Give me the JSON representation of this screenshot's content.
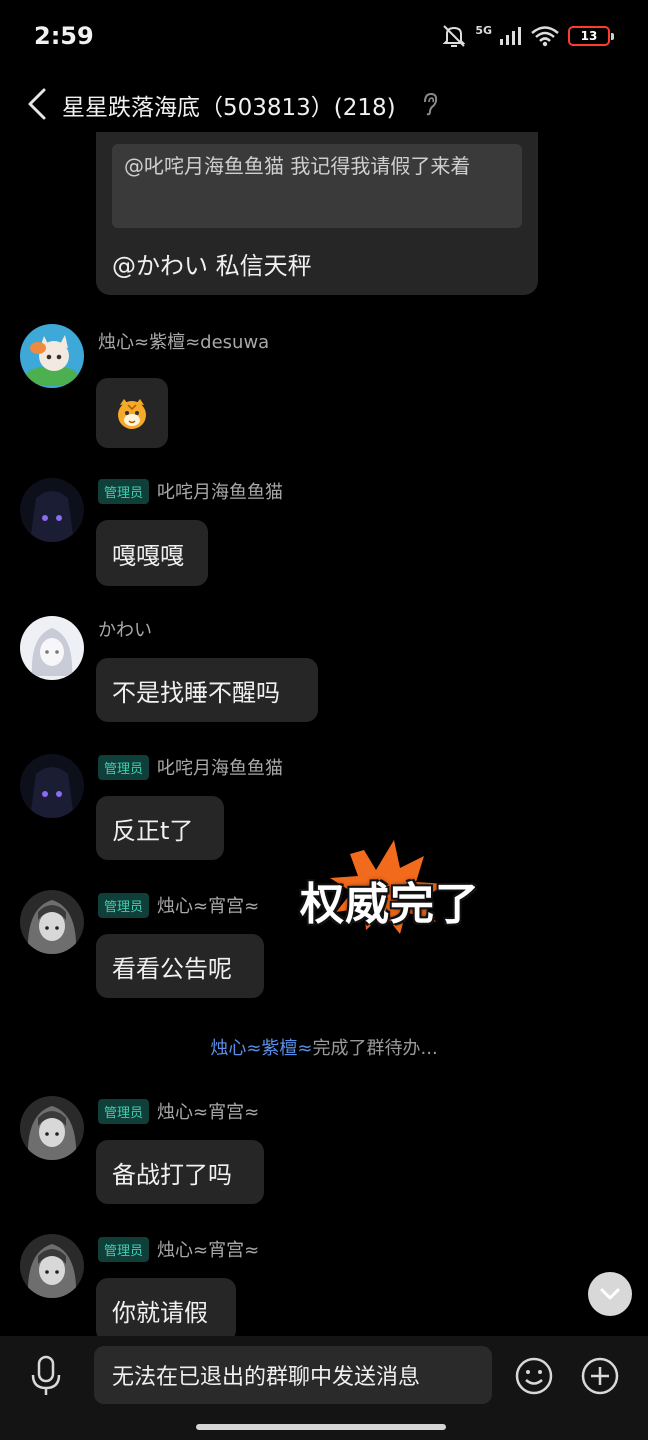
{
  "status": {
    "time": "2:59",
    "network": "5G",
    "battery": "13"
  },
  "header": {
    "title": "星星跌落海底（503813）(218)",
    "ear_icon": "hearing-icon"
  },
  "quote_message": {
    "quoted_text": "@叱咤月海鱼鱼猫 我记得我请假了来着",
    "reply_text": "@かわい 私信天秤"
  },
  "messages": [
    {
      "sender": "烛心≈紫檀≈desuwa",
      "admin": false,
      "text": "",
      "sticker": "tiger-emoji"
    },
    {
      "sender": "叱咤月海鱼鱼猫",
      "admin": true,
      "badge": "管理员",
      "text": "嘎嘎嘎"
    },
    {
      "sender": "かわい",
      "admin": false,
      "text": "不是找睡不醒吗"
    },
    {
      "sender": "叱咤月海鱼鱼猫",
      "admin": true,
      "badge": "管理员",
      "text": "反正t了"
    },
    {
      "sender": "烛心≈宵宫≈",
      "admin": true,
      "badge": "管理员",
      "text": "看看公告呢"
    },
    {
      "sender": "烛心≈宵宫≈",
      "admin": true,
      "badge": "管理员",
      "text": "备战打了吗"
    },
    {
      "sender": "烛心≈宵宫≈",
      "admin": true,
      "badge": "管理员",
      "text": "你就请假"
    }
  ],
  "system_message": {
    "who": "烛心≈紫檀≈",
    "action": "完成了群待办..."
  },
  "overlay_sticker": {
    "text": "权威完了",
    "burst_color": "#f26a1b"
  },
  "input_bar": {
    "placeholder": "无法在已退出的群聊中发送消息"
  }
}
